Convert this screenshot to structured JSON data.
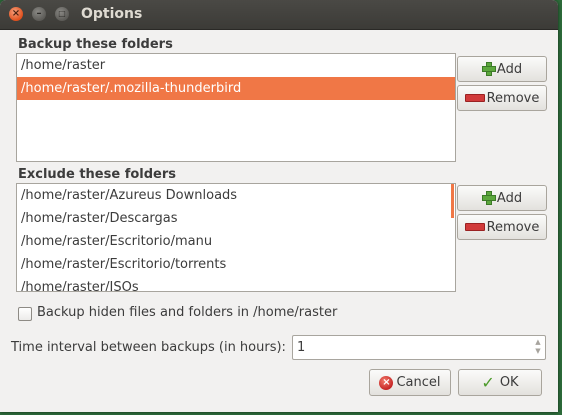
{
  "window": {
    "title": "Options",
    "controls": {
      "close": "×",
      "minimize": "–",
      "maximize": "□"
    }
  },
  "backup": {
    "label": "Backup these folders",
    "items": [
      {
        "path": "/home/raster",
        "selected": false
      },
      {
        "path": "/home/raster/.mozilla-thunderbird",
        "selected": true
      }
    ],
    "add_label": "Add",
    "remove_label": "Remove"
  },
  "exclude": {
    "label": "Exclude these folders",
    "items": [
      {
        "path": "/home/raster/Azureus Downloads"
      },
      {
        "path": "/home/raster/Descargas"
      },
      {
        "path": "/home/raster/Escritorio/manu"
      },
      {
        "path": "/home/raster/Escritorio/torrents"
      },
      {
        "path": "/home/raster/ISOs"
      }
    ],
    "add_label": "Add",
    "remove_label": "Remove"
  },
  "hidden_files": {
    "label": "Backup hiden files and folders in /home/raster",
    "checked": false
  },
  "interval": {
    "label": "Time interval between backups (in hours):",
    "value": "1"
  },
  "buttons": {
    "cancel_label": "Cancel",
    "ok_label": "OK"
  },
  "colors": {
    "accent": "#f07746",
    "titlebar": "#3c3b37",
    "window_bg": "#f2f1f0"
  },
  "icons": [
    "close-icon",
    "minimize-icon",
    "maximize-icon",
    "plus-icon",
    "minus-icon",
    "cancel-icon",
    "checkmark-icon"
  ]
}
